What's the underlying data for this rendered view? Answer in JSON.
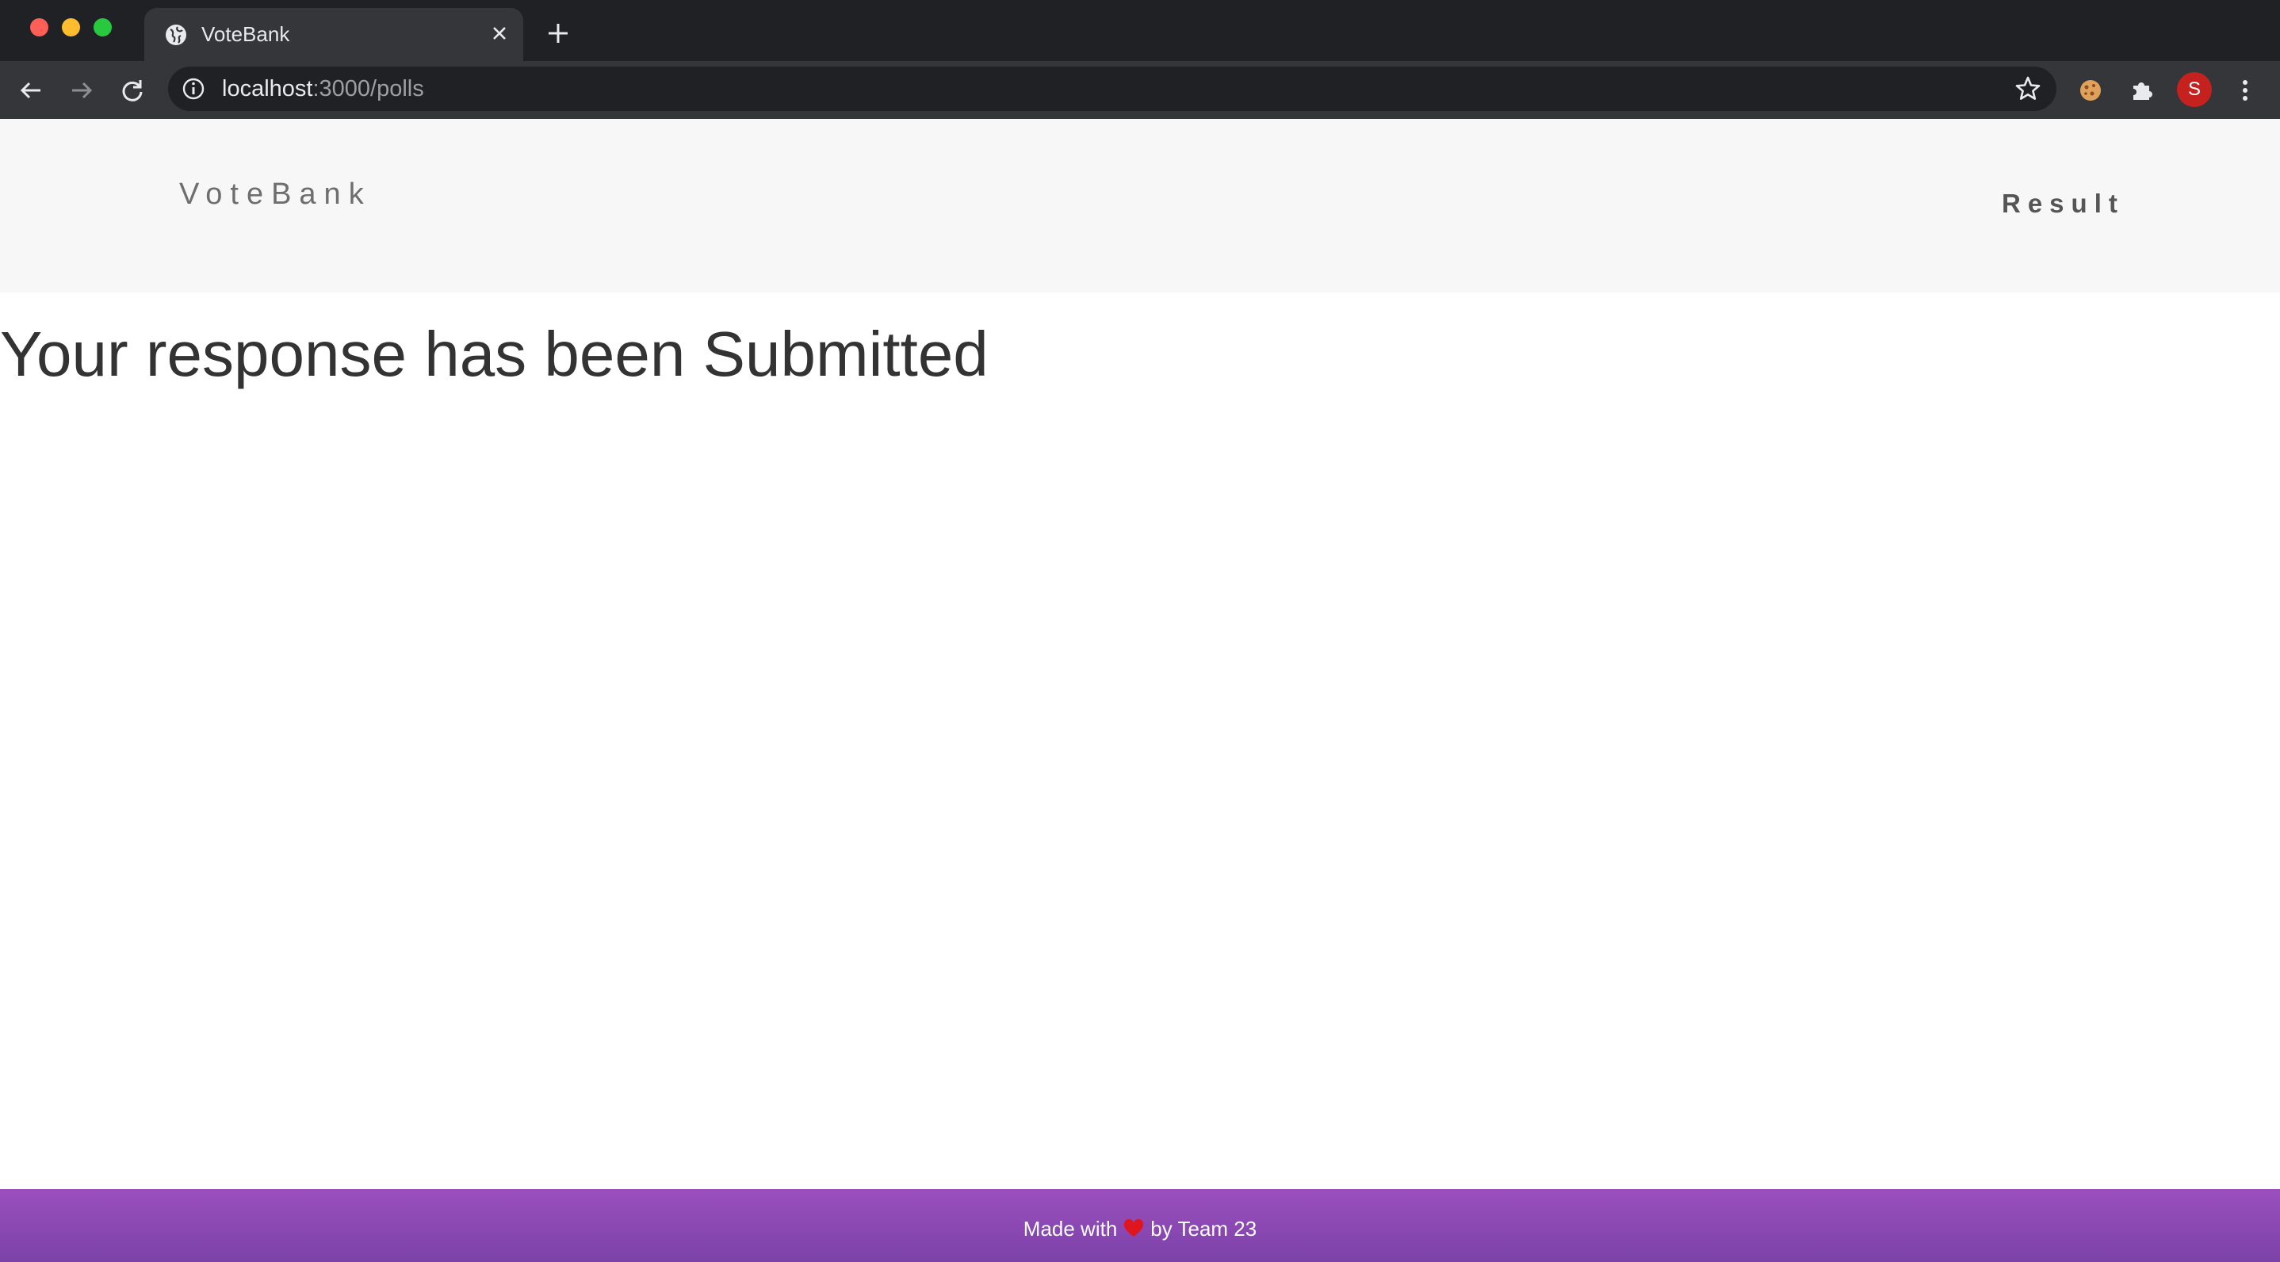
{
  "browser": {
    "tab": {
      "title": "VoteBank",
      "favicon": "globe-icon"
    },
    "url": {
      "host": "localhost",
      "path": ":3000/polls"
    },
    "profile_initial": "S",
    "colors": {
      "tabstrip": "#202124",
      "toolbar": "#35363a",
      "avatar": "#c5221f"
    }
  },
  "site": {
    "brand": "VoteBank",
    "nav": {
      "result_label": "Result"
    }
  },
  "main": {
    "headline": "Your response has been Submitted"
  },
  "footer": {
    "prefix": "Made with",
    "icon": "heart-icon",
    "suffix": "by Team 23",
    "colors": {
      "gradient_top": "#9b4fbe",
      "gradient_bottom": "#7b42a8"
    }
  }
}
